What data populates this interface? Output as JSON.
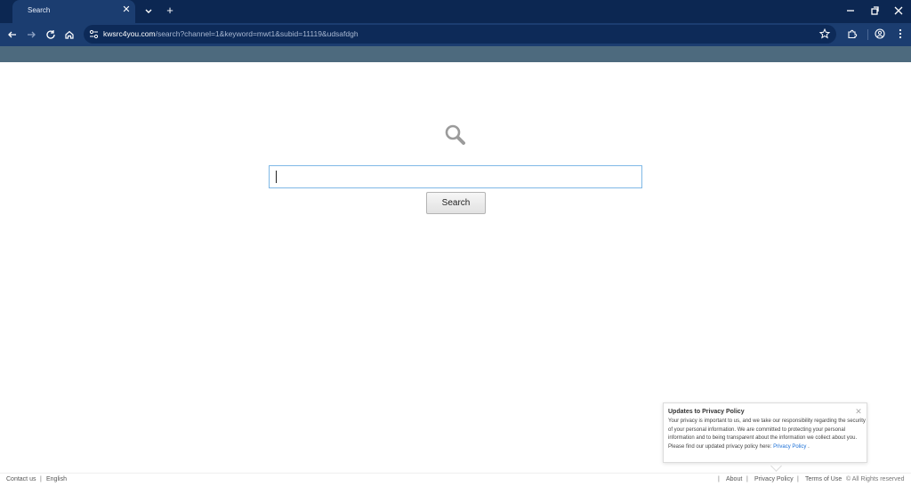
{
  "browser": {
    "tab_title": "Search",
    "url_host": "kwsrc4you.com",
    "url_rest": "/search?channel=1&keyword=mwt1&subid=11119&udsafdgh"
  },
  "page": {
    "search_input_value": "",
    "search_button_label": "Search"
  },
  "footer": {
    "contact": "Contact us",
    "sep": "|",
    "language": "English",
    "about": "About",
    "privacy": "Privacy Policy",
    "terms": "Terms of Use",
    "rights": "© All Rights reserved"
  },
  "privacy_popup": {
    "title": "Updates to Privacy Policy",
    "body": "Your privacy is important to us, and we take our responsibility regarding the security of your personal information. We are committed to protecting your personal information and to being transparent about the information we collect about you. Please find our updated privacy policy here:",
    "link": "Privacy Policy",
    "trailing": "."
  },
  "colors": {
    "chrome_dark": "#0c2752",
    "chrome_toolbar": "#1b3d70",
    "banner": "#4d6a7e",
    "link_blue": "#1a6fd6",
    "search_border": "#7fb8e6"
  },
  "icons": {
    "tab_close": "close-icon",
    "tab_list": "chevron-down-icon",
    "new_tab": "plus-icon",
    "back": "arrow-left-icon",
    "forward": "arrow-right-icon",
    "reload": "reload-icon",
    "home": "home-icon",
    "site_info": "tune-icon",
    "bookmark": "star-icon",
    "extensions": "puzzle-icon",
    "profile": "profile-icon",
    "menu": "kebab-menu-icon",
    "logo": "magnifier-icon"
  }
}
